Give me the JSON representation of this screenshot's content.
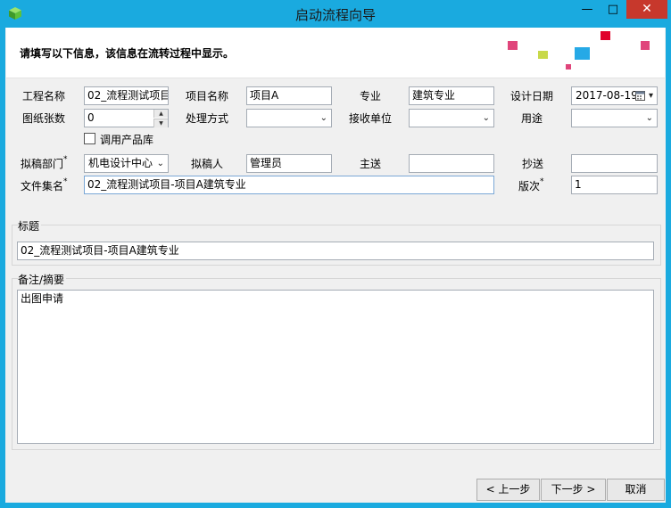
{
  "window": {
    "title": "启动流程向导",
    "minimize_glyph": "—",
    "maximize_glyph": "□",
    "close_glyph": "✕"
  },
  "header": {
    "instruction": "请填写以下信息，该信息在流转过程中显示。"
  },
  "form": {
    "project_name": {
      "label": "工程名称",
      "value": "02_流程测试项目"
    },
    "item_name": {
      "label": "项目名称",
      "value": "项目A"
    },
    "specialty": {
      "label": "专业",
      "value": "建筑专业"
    },
    "design_date": {
      "label": "设计日期",
      "value": "2017-08-19"
    },
    "drawing_count": {
      "label": "图纸张数",
      "value": "0"
    },
    "handling_method": {
      "label": "处理方式",
      "value": ""
    },
    "receiving_unit": {
      "label": "接收单位",
      "value": ""
    },
    "purpose": {
      "label": "用途",
      "value": ""
    },
    "use_product_lib": {
      "label": "调用产品库",
      "checked": false
    },
    "draft_dept": {
      "label": "拟稿部门",
      "required_mark": "*",
      "value": "机电设计中心"
    },
    "drafter": {
      "label": "拟稿人",
      "value": "管理员"
    },
    "main_send": {
      "label": "主送",
      "value": ""
    },
    "cc": {
      "label": "抄送",
      "value": ""
    },
    "file_set_name": {
      "label": "文件集名",
      "required_mark": "*",
      "value": "02_流程测试项目-项目A建筑专业"
    },
    "version": {
      "label": "版次",
      "required_mark": "*",
      "value": "1"
    }
  },
  "title_group": {
    "label": "标题",
    "value": "02_流程测试项目-项目A建筑专业"
  },
  "remarks_group": {
    "label": "备注/摘要",
    "value": "出图申请"
  },
  "footer": {
    "prev_label": "< 上一步",
    "next_label": "下一步 >",
    "cancel_label": "取消"
  },
  "icons": {
    "app": "cube-icon",
    "calendar": "calendar-icon",
    "dropdown": "chevron-down-icon",
    "spin_up": "spin-up-icon",
    "spin_down": "spin-down-icon"
  },
  "colors": {
    "titlebar": "#1aaadf",
    "close_button": "#c7382c",
    "window_body": "#f0f0f0",
    "header_background": "#ffffff",
    "deco_pink": "#e0457b",
    "deco_red": "#e0002a",
    "deco_green": "#c8d94a",
    "deco_blue": "#26a9e6"
  }
}
